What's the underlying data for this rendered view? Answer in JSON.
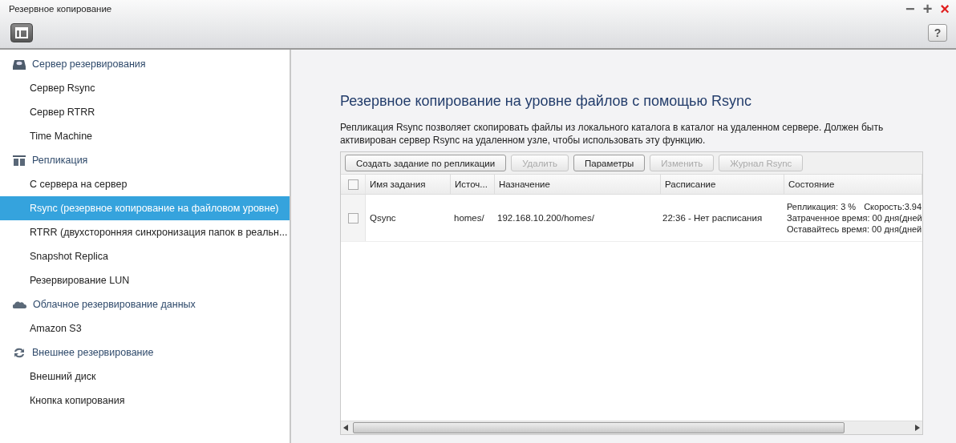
{
  "window": {
    "title": "Резервное копирование",
    "controls": [
      "−",
      "+",
      "×"
    ]
  },
  "toolbar": {
    "help": "?"
  },
  "sidebar": {
    "groups": [
      {
        "label": "Сервер резервирования",
        "children": [
          {
            "label": "Сервер Rsync",
            "selected": false
          },
          {
            "label": "Сервер RTRR",
            "selected": false
          },
          {
            "label": "Time Machine",
            "selected": false
          }
        ]
      },
      {
        "label": "Репликация",
        "children": [
          {
            "label": "С сервера на сервер",
            "selected": false
          },
          {
            "label": "Rsync (резервное копирование на файловом уровне)",
            "selected": true
          },
          {
            "label": "RTRR (двухсторонняя синхронизация папок в реальн...",
            "selected": false
          },
          {
            "label": "Snapshot Replica",
            "selected": false
          },
          {
            "label": "Резервирование LUN",
            "selected": false
          }
        ]
      },
      {
        "label": "Облачное резервирование данных",
        "children": [
          {
            "label": "Amazon S3",
            "selected": false
          }
        ]
      },
      {
        "label": "Внешнее резервирование",
        "children": [
          {
            "label": "Внешний диск",
            "selected": false
          },
          {
            "label": "Кнопка копирования",
            "selected": false
          }
        ]
      }
    ]
  },
  "content": {
    "heading": "Резервное копирование на уровне файлов с помощью Rsync",
    "description": "Репликация Rsync позволяет скопировать файлы из локального каталога в каталог на удаленном сервере. Должен быть активирован сервер Rsync на удаленном узле, чтобы использовать эту функцию.",
    "buttons": [
      {
        "label": "Создать задание по репликации",
        "disabled": false
      },
      {
        "label": "Удалить",
        "disabled": true
      },
      {
        "label": "Параметры",
        "disabled": false
      },
      {
        "label": "Изменить",
        "disabled": true
      },
      {
        "label": "Журнал Rsync",
        "disabled": true
      }
    ],
    "table": {
      "select_all_checked": false,
      "columns": [
        "Имя задания",
        "Источ...",
        "Назначение",
        "Расписание",
        "Состояние"
      ],
      "rows": [
        {
          "checked": false,
          "cells": [
            "Qsync",
            "homes/",
            "192.168.10.200/homes/",
            "22:36 - Нет расписания"
          ],
          "status": [
            "Репликация: 3 %",
            "Скорость:3.94",
            "Затраченное время: 00 дня(дней",
            "Оставайтесь время: 00 дня(дней"
          ]
        }
      ]
    }
  }
}
